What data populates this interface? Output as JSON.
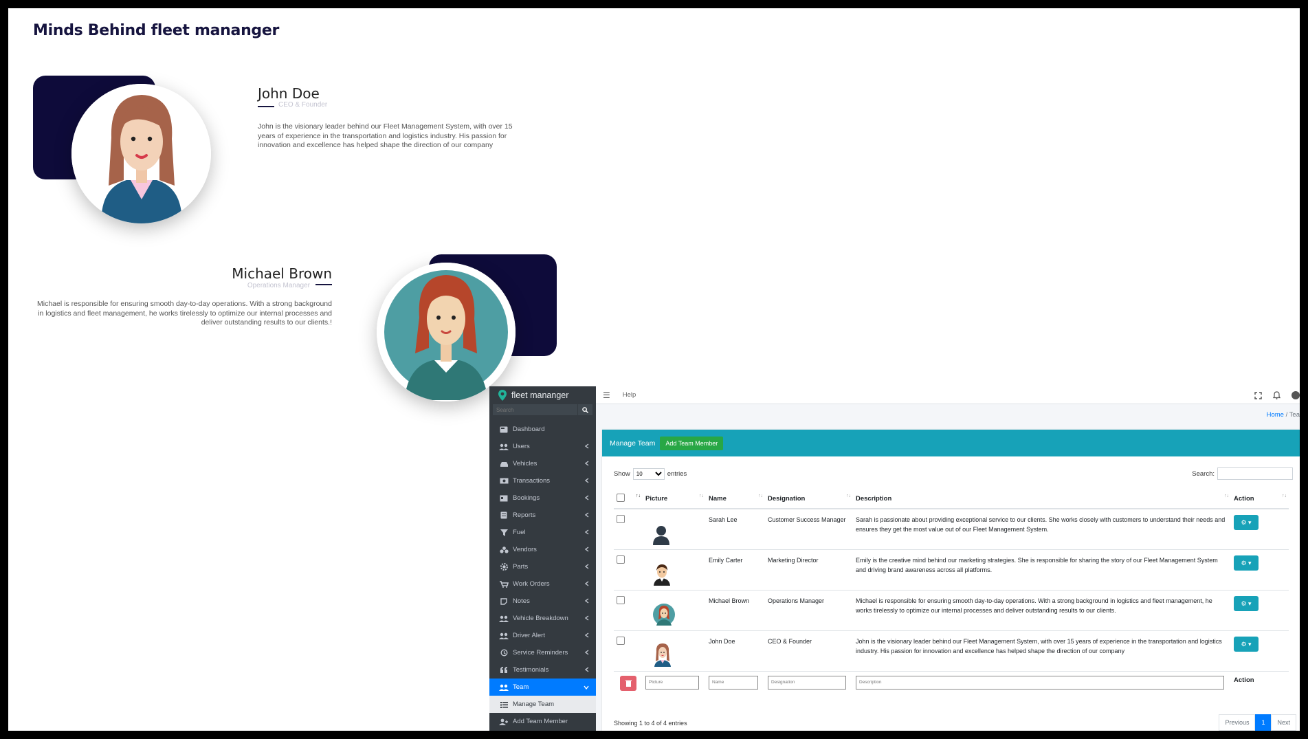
{
  "landing": {
    "title": "Minds Behind fleet mananger",
    "members": [
      {
        "name": "John Doe",
        "role": "CEO & Founder",
        "bio": "John is the visionary leader behind our Fleet Management System, with over 15 years of experience in the transportation and logistics industry. His passion for innovation and excellence has helped shape the direction of our company"
      },
      {
        "name": "Michael Brown",
        "role": "Operations Manager",
        "bio": "Michael is responsible for ensuring smooth day-to-day operations. With a strong background in logistics and fleet management, he works tirelessly to optimize our internal processes and deliver outstanding results to our clients.!"
      }
    ]
  },
  "admin": {
    "brand": "fleet mananger",
    "search_placeholder": "Search",
    "topbar": {
      "help": "Help"
    },
    "breadcrumb": {
      "home": "Home",
      "sep": "/",
      "current": "Tea"
    },
    "sidebar": {
      "items": [
        {
          "label": "Dashboard",
          "icon": "dashboard-icon"
        },
        {
          "label": "Users",
          "icon": "users-icon"
        },
        {
          "label": "Vehicles",
          "icon": "car-icon"
        },
        {
          "label": "Transactions",
          "icon": "money-icon"
        },
        {
          "label": "Bookings",
          "icon": "booking-icon"
        },
        {
          "label": "Reports",
          "icon": "report-icon"
        },
        {
          "label": "Fuel",
          "icon": "filter-icon"
        },
        {
          "label": "Vendors",
          "icon": "vendors-icon"
        },
        {
          "label": "Parts",
          "icon": "gear-icon"
        },
        {
          "label": "Work Orders",
          "icon": "cart-icon"
        },
        {
          "label": "Notes",
          "icon": "note-icon"
        },
        {
          "label": "Vehicle Breakdown",
          "icon": "users-icon"
        },
        {
          "label": "Driver Alert",
          "icon": "users-icon"
        },
        {
          "label": "Service Reminders",
          "icon": "history-icon"
        },
        {
          "label": "Testimonials",
          "icon": "quote-icon"
        },
        {
          "label": "Team",
          "icon": "users-icon"
        },
        {
          "label": "Manage Team",
          "icon": "list-icon"
        },
        {
          "label": "Add Team Member",
          "icon": "user-plus-icon"
        }
      ]
    },
    "card": {
      "title": "Manage Team",
      "add_button": "Add Team Member",
      "show": "Show",
      "entries_value": "10",
      "entries": "entries",
      "search_label": "Search:",
      "columns": [
        "Picture",
        "Name",
        "Designation",
        "Description",
        "Action"
      ],
      "rows": [
        {
          "name": "Sarah Lee",
          "designation": "Customer Success Manager",
          "description": "Sarah is passionate about providing exceptional service to our clients. She works closely with customers to understand their needs and ensures they get the most value out of our Fleet Management System.",
          "avatar": "user-silhouette-icon"
        },
        {
          "name": "Emily Carter",
          "designation": "Marketing Director",
          "description": "Emily is the creative mind behind our marketing strategies. She is responsible for sharing the story of our Fleet Management System and driving brand awareness across all platforms.",
          "avatar": "man-avatar-icon"
        },
        {
          "name": "Michael Brown",
          "designation": "Operations Manager",
          "description": "Michael is responsible for ensuring smooth day-to-day operations. With a strong background in logistics and fleet management, he works tirelessly to optimize our internal processes and deliver outstanding results to our clients.",
          "avatar": "woman-avatar-icon"
        },
        {
          "name": "John Doe",
          "designation": "CEO & Founder",
          "description": "John is the visionary leader behind our Fleet Management System, with over 15 years of experience in the transportation and logistics industry. His passion for innovation and excellence has helped shape the direction of our company",
          "avatar": "woman-avatar-icon"
        }
      ],
      "filters": {
        "picture": "Picture",
        "name": "Name",
        "designation": "Designation",
        "description": "Description",
        "action": "Action"
      },
      "footer": "Showing 1 to 4 of 4 entries",
      "pager": {
        "previous": "Previous",
        "page": "1",
        "next": "Next"
      }
    },
    "colors": {
      "sidebar": "#343a40",
      "header": "#17a2b8",
      "primary": "#007bff",
      "success": "#28a745",
      "danger": "#e4606d",
      "navy": "#0e0b3a"
    }
  }
}
